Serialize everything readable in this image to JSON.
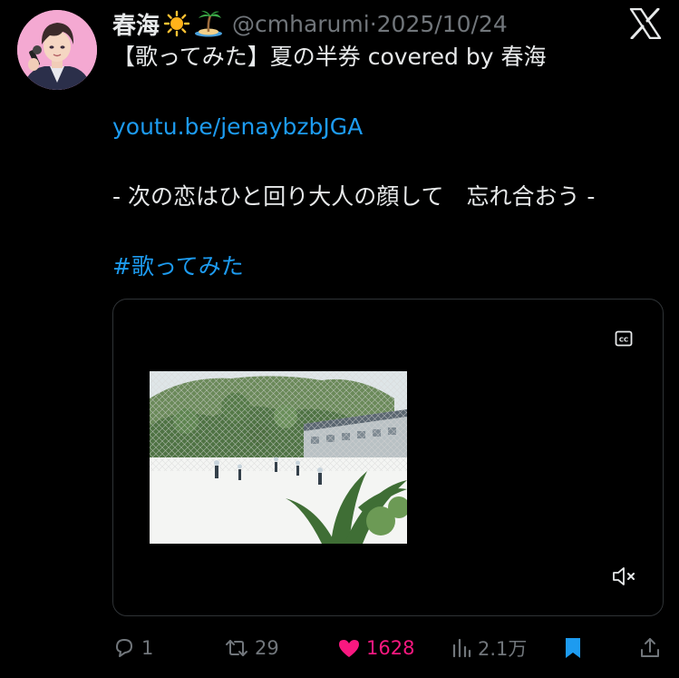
{
  "author": {
    "display_name": "春海",
    "name_emojis": [
      "sun-emoji",
      "island-emoji"
    ],
    "handle": "@cmharumi",
    "separator": "·",
    "date": "2025/10/24"
  },
  "tweet": {
    "title_line": "【歌ってみた】夏の半券 covered by 春海",
    "link": "youtu.be/jenaybzbJGA",
    "lyric_line": "- 次の恋はひと回り大人の顔して　忘れ合おう -",
    "hashtag": "#歌ってみた"
  },
  "media": {
    "type": "video",
    "icons": [
      "closed-captions-icon",
      "muted-volume-icon"
    ]
  },
  "actions": {
    "replies": "1",
    "retweets": "29",
    "likes": "1628",
    "views": "2.1万"
  },
  "colors": {
    "background": "#000000",
    "text": "#e7e9ea",
    "secondary": "#71767b",
    "link": "#1d9bf0",
    "like": "#f91880",
    "bookmark": "#1d9bf0"
  }
}
